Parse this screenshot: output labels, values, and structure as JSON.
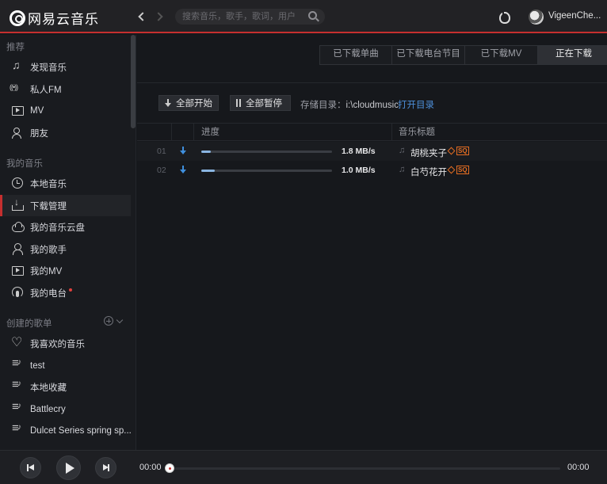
{
  "app": {
    "logo_text": "网易云音乐"
  },
  "titlebar": {
    "search_placeholder": "搜索音乐，歌手，歌词，用户",
    "username": "VigeenChe..."
  },
  "sidebar": {
    "sections": [
      {
        "title": "推荐"
      },
      {
        "title": "我的音乐"
      },
      {
        "title": "创建的歌单"
      }
    ],
    "recommend_items": [
      {
        "label": "发现音乐",
        "icon": "music-note-icon"
      },
      {
        "label": "私人FM",
        "icon": "radio-icon"
      },
      {
        "label": "MV",
        "icon": "tv-icon"
      },
      {
        "label": "朋友",
        "icon": "friends-icon"
      }
    ],
    "my_music_items": [
      {
        "label": "本地音乐",
        "icon": "clock-icon"
      },
      {
        "label": "下载管理",
        "icon": "download-icon",
        "active": true
      },
      {
        "label": "我的音乐云盘",
        "icon": "cloud-icon"
      },
      {
        "label": "我的歌手",
        "icon": "singer-icon"
      },
      {
        "label": "我的MV",
        "icon": "tv-icon"
      },
      {
        "label": "我的电台",
        "icon": "podcast-icon"
      }
    ],
    "playlist_items": [
      {
        "label": "我喜欢的音乐",
        "icon": "heart-icon"
      },
      {
        "label": "test",
        "icon": "playlist-icon"
      },
      {
        "label": "本地收藏",
        "icon": "playlist-icon"
      },
      {
        "label": "Battlecry",
        "icon": "playlist-icon"
      },
      {
        "label": "Dulcet Series spring sp...",
        "icon": "playlist-icon"
      }
    ]
  },
  "main": {
    "tabs": [
      {
        "label": "已下载单曲"
      },
      {
        "label": "已下载电台节目"
      },
      {
        "label": "已下载MV"
      },
      {
        "label": "正在下载",
        "active": true
      }
    ],
    "buttons": {
      "start_all": "全部开始",
      "pause_all": "全部暂停"
    },
    "storage_label": "存储目录：",
    "storage_path": "i:\\cloudmusic",
    "open_dir": "打开目录",
    "table": {
      "headers": {
        "progress": "进度",
        "title": "音乐标题"
      },
      "rows": [
        {
          "num": "01",
          "progress": 0.07,
          "speed": "1.8 MB/s",
          "title": "胡桃夹子",
          "quality": "SQ"
        },
        {
          "num": "02",
          "progress": 0.1,
          "speed": "1.0 MB/s",
          "title": "白芍花开",
          "quality": "SQ"
        }
      ]
    }
  },
  "player": {
    "time_current": "00:00",
    "time_total": "00:00",
    "progress": 0
  },
  "colors": {
    "accent": "#c62f2f",
    "link": "#4d8fd9",
    "download_arrow": "#3f8fdd",
    "quality_badge": "#e26c22"
  }
}
